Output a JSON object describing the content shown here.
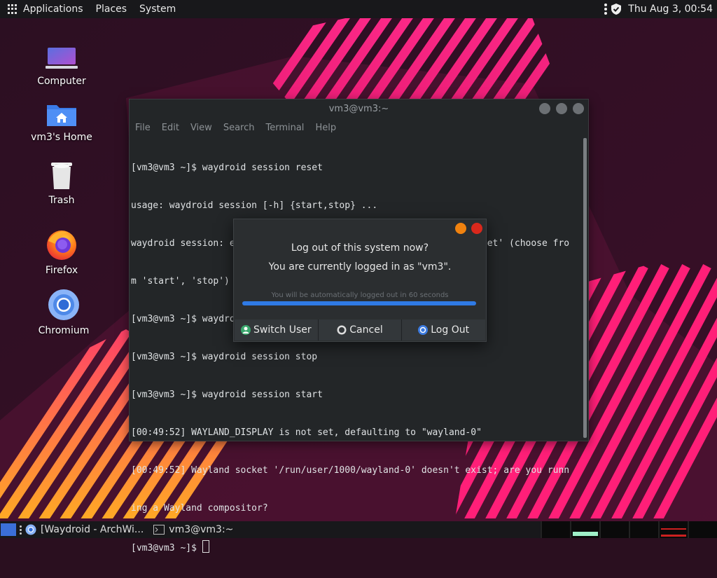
{
  "top_panel": {
    "menus": [
      "Applications",
      "Places",
      "System"
    ],
    "clock": "Thu Aug  3, 00:54"
  },
  "desktop_icons": [
    {
      "label": "Computer",
      "icon": "computer-icon"
    },
    {
      "label": "vm3's Home",
      "icon": "home-folder-icon"
    },
    {
      "label": "Trash",
      "icon": "trash-icon"
    },
    {
      "label": "Firefox",
      "icon": "firefox-icon"
    },
    {
      "label": "Chromium",
      "icon": "chromium-icon"
    }
  ],
  "terminal": {
    "title": "vm3@vm3:~",
    "menu": [
      "File",
      "Edit",
      "View",
      "Search",
      "Terminal",
      "Help"
    ],
    "lines": [
      "[vm3@vm3 ~]$ waydroid session reset",
      "usage: waydroid session [-h] {start,stop} ...",
      "waydroid session: error: argument subaction: invalid choice: 'reset' (choose fro",
      "m 'start', 'stop')",
      "[vm3@vm3 ~]$ waydroid session stop",
      "[vm3@vm3 ~]$ waydroid session stop",
      "[vm3@vm3 ~]$ waydroid session start",
      "[00:49:52] WAYLAND_DISPLAY is not set, defaulting to \"wayland-0\"",
      "[00:49:52] Wayland socket '/run/user/1000/wayland-0' doesn't exist; are you runn",
      "ing a Wayland compositor?",
      "[vm3@vm3 ~]$ "
    ]
  },
  "logout_dialog": {
    "title": "Log out of this system now?",
    "subtitle": "You are currently logged in as \"vm3\".",
    "countdown_note": "You will be automatically logged out in 60 seconds",
    "progress_fraction": 1.0,
    "buttons": {
      "switch_user": "Switch User",
      "cancel": "Cancel",
      "log_out": "Log Out"
    },
    "colors": {
      "minimize": "#f0820f",
      "close": "#d9281c",
      "progress": "#2f7ae5"
    }
  },
  "taskbar": {
    "tasks": [
      {
        "label": "[Waydroid - ArchWi...",
        "icon": "chromium-icon"
      },
      {
        "label": "vm3@vm3:~",
        "icon": "terminal-icon"
      }
    ]
  }
}
